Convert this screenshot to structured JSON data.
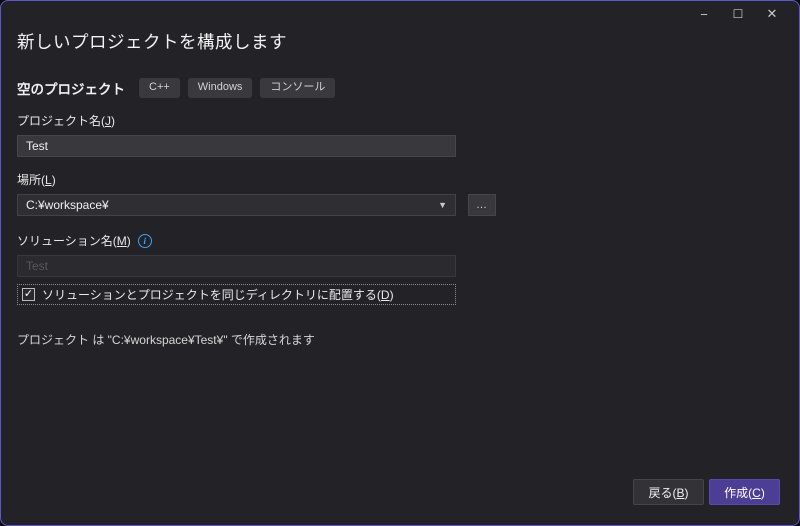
{
  "colors": {
    "window-bg": "#232327",
    "window-border": "#5e57cf",
    "accent": "#4b3e94",
    "accent-border": "#5a4cae",
    "info-blue": "#3aa0f3"
  },
  "window": {
    "controls": {
      "minimize": "−",
      "maximize": "☐",
      "close": "✕"
    },
    "title": "新しいプロジェクトを構成します"
  },
  "project_type": {
    "label": "空のプロジェクト",
    "tags": [
      "C++",
      "Windows",
      "コンソール"
    ]
  },
  "fields": {
    "project_name": {
      "label_prefix": "プロジェクト名(",
      "access_key": "J",
      "label_suffix": ")",
      "value": "Test"
    },
    "location": {
      "label_prefix": "場所(",
      "access_key": "L",
      "label_suffix": ")",
      "value": "C:¥workspace¥",
      "caret_icon": "▼",
      "browse_icon": "…"
    },
    "solution_name": {
      "label_prefix": "ソリューション名(",
      "access_key": "M",
      "label_suffix": ")",
      "info_icon": "i",
      "value": "Test",
      "disabled": true
    },
    "same_directory_checkbox": {
      "checked": true,
      "check_icon": "✓",
      "label_prefix": "ソリューションとプロジェクトを同じディレクトリに配置する(",
      "access_key": "D",
      "label_suffix": ")"
    }
  },
  "note": "プロジェクト は \"C:¥workspace¥Test¥\" で作成されます",
  "footer": {
    "back_button": {
      "label_prefix": "戻る(",
      "access_key": "B",
      "label_suffix": ")"
    },
    "create_button": {
      "label_prefix": "作成(",
      "access_key": "C",
      "label_suffix": ")"
    }
  }
}
